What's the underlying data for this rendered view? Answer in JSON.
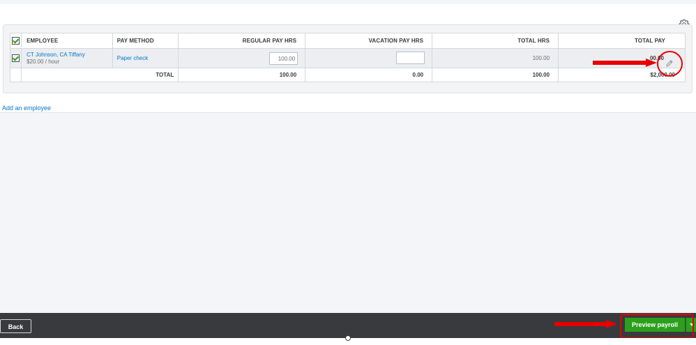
{
  "table": {
    "headers": {
      "employee": "EMPLOYEE",
      "pay_method": "PAY METHOD",
      "regular_pay_hrs": "REGULAR PAY HRS",
      "vacation_pay_hrs": "VACATION PAY HRS",
      "total_hrs": "TOTAL HRS",
      "total_pay": "TOTAL PAY"
    },
    "rows": [
      {
        "selected": true,
        "name": "CT Johnson, CA Tiffany",
        "rate": "$20.00 / hour",
        "pay_method": "Paper check",
        "regular_pay_hrs": "100.00",
        "vacation_pay_hrs": "",
        "total_hrs": "100.00",
        "total_pay": "$2,000.00",
        "total_pay_visible": "00.00"
      }
    ],
    "totals": {
      "label": "TOTAL",
      "regular_pay_hrs": "100.00",
      "vacation_pay_hrs": "0.00",
      "total_hrs": "100.00",
      "total_pay": "$2,000.00"
    }
  },
  "links": {
    "add_employee": "Add an employee"
  },
  "footer": {
    "back": "Back",
    "preview_payroll": "Preview payroll"
  },
  "icons": {
    "settings": "gear-icon",
    "edit": "pencil-icon",
    "dropdown": "caret-down-icon"
  },
  "colors": {
    "accent": "#2ca01c",
    "link": "#0077c5",
    "annotation": "#e60000",
    "footer_bg": "#393a3d"
  }
}
